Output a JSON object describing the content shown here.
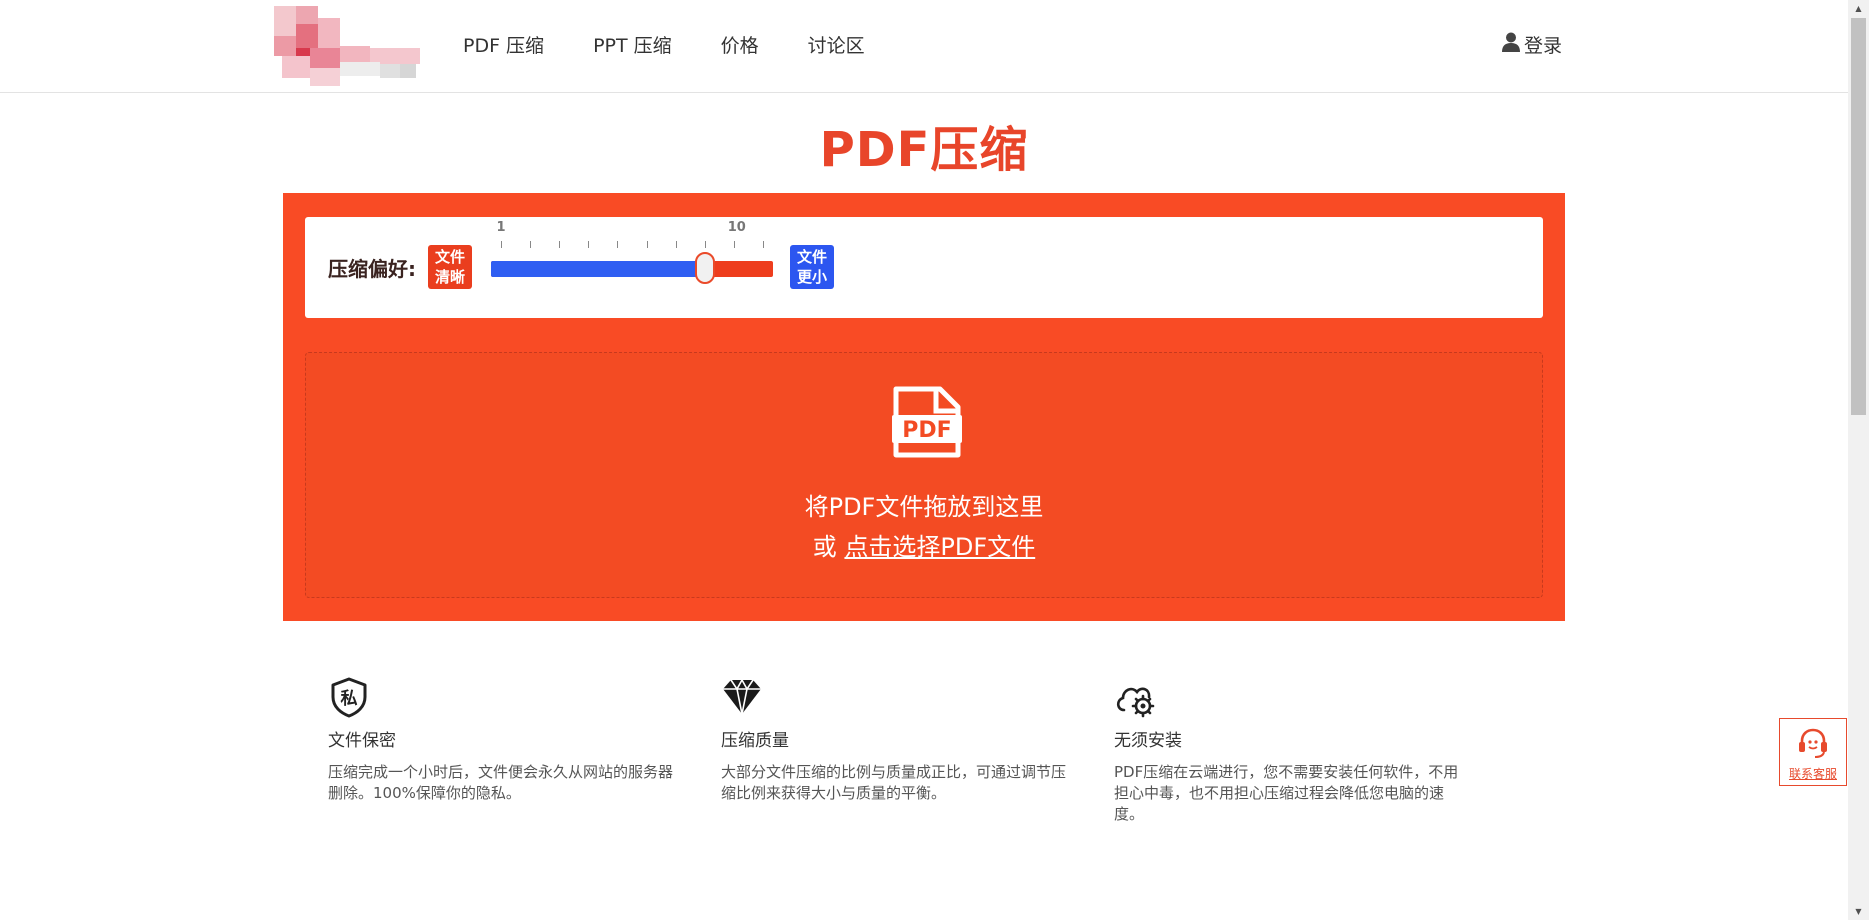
{
  "header": {
    "nav": [
      {
        "label": "PDF 压缩"
      },
      {
        "label": "PPT 压缩"
      },
      {
        "label": "价格"
      },
      {
        "label": "讨论区"
      }
    ],
    "login_label": "登录"
  },
  "title": "PDF压缩",
  "preference": {
    "label": "压缩偏好:",
    "left_tag": [
      "文件",
      "清晰"
    ],
    "right_tag": [
      "文件",
      "更小"
    ],
    "slider": {
      "min": 1,
      "max": 10,
      "min_label": "1",
      "max_label": "10",
      "value": 8
    }
  },
  "upload": {
    "icon_text": "PDF",
    "drag_text": "将PDF文件拖放到这里",
    "or_text": "或",
    "choose_text": "点击选择PDF文件"
  },
  "features": [
    {
      "icon": "shield-private-icon",
      "icon_char": "私",
      "title": "文件保密",
      "desc": "压缩完成一个小时后，文件便会永久从网站的服务器删除。100%保障你的隐私。"
    },
    {
      "icon": "diamond-icon",
      "title": "压缩质量",
      "desc": "大部分文件压缩的比例与质量成正比，可通过调节压缩比例来获得大小与质量的平衡。"
    },
    {
      "icon": "cloud-gear-icon",
      "title": "无须安装",
      "desc": "PDF压缩在云端进行，您不需要安装任何软件，不用担心中毒，也不用担心压缩过程会降低您电脑的速度。"
    }
  ],
  "customer_service": {
    "label": "联系客服"
  },
  "colors": {
    "brand": "#f94b25",
    "title": "#e8452a",
    "blue": "#2c56f0"
  }
}
